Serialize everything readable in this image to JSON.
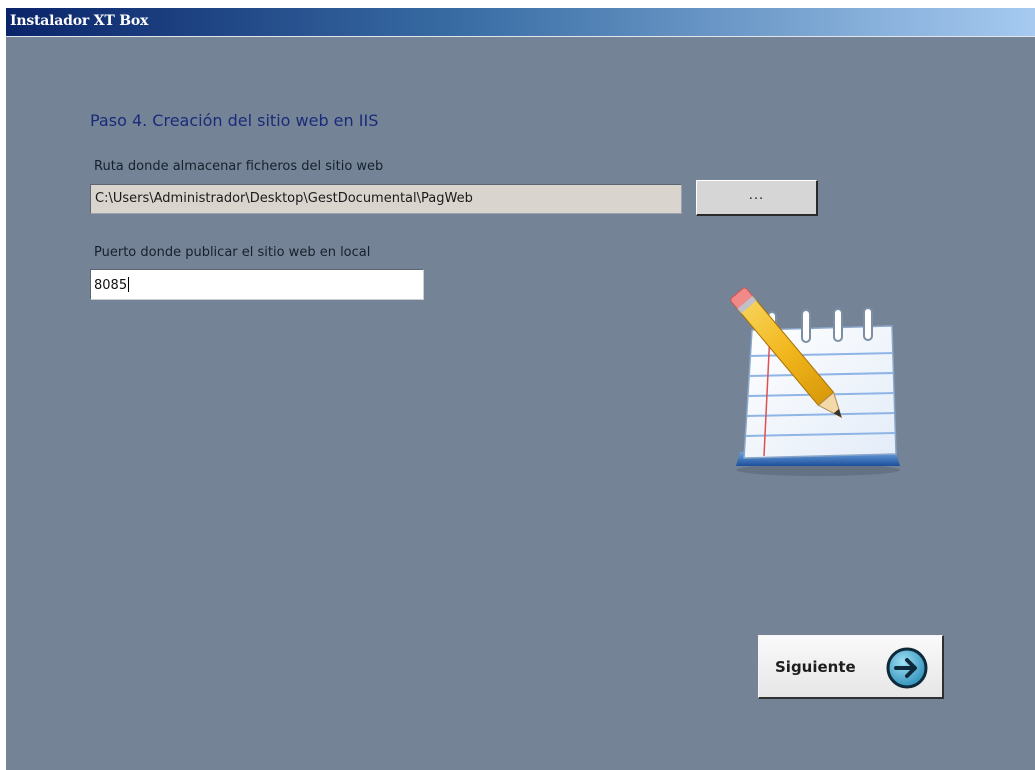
{
  "window": {
    "title": "Instalador XT Box"
  },
  "step": {
    "title": "Paso 4. Creación del sitio web en IIS"
  },
  "path_section": {
    "label": "Ruta donde almacenar ficheros del sitio web",
    "value": "C:\\Users\\Administrador\\Desktop\\GestDocumental\\PagWeb",
    "browse_label": "..."
  },
  "port_section": {
    "label": "Puerto donde publicar el sitio web en local",
    "value": "8085"
  },
  "footer": {
    "next_label": "Siguiente",
    "next_icon": "arrow-right-circle-icon"
  },
  "illustration": {
    "icon": "notepad-pencil-icon"
  },
  "colors": {
    "window_background": "#748496",
    "step_title": "#1a2a7a",
    "titlebar_start": "#0a246a",
    "titlebar_end": "#a6caf0"
  }
}
